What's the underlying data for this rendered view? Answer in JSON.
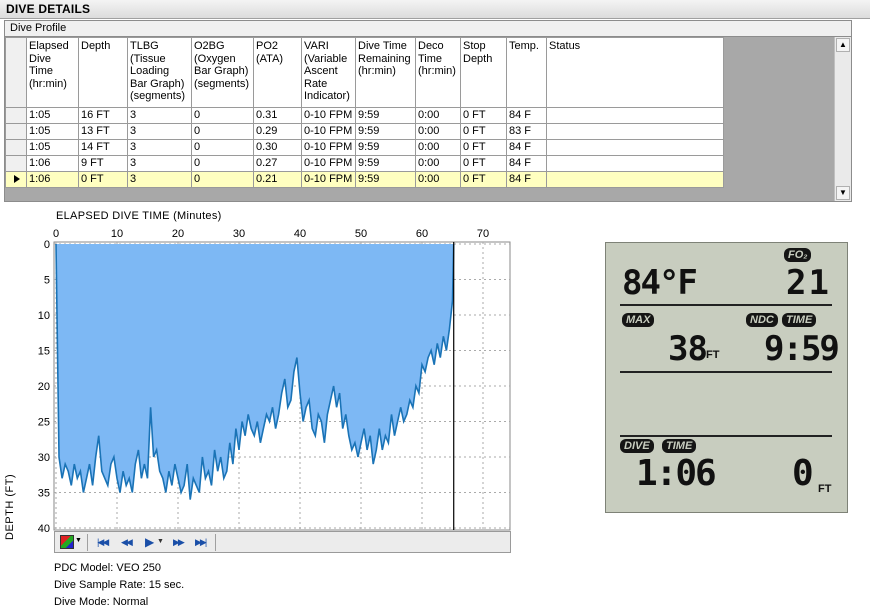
{
  "header": {
    "title": "DIVE DETAILS"
  },
  "profile": {
    "label": "Dive Profile",
    "columns": [
      "Elapsed Dive Time (hr:min)",
      "Depth",
      "TLBG (Tissue Loading Bar Graph) (segments)",
      "O2BG (Oxygen Bar Graph) (segments)",
      "PO2 (ATA)",
      "VARI (Variable Ascent Rate Indicator)",
      "Dive Time Remaining (hr:min)",
      "Deco Time (hr:min)",
      "Stop Depth",
      "Temp.",
      "Status"
    ],
    "rows": [
      [
        "1:05",
        "16 FT",
        "3",
        "0",
        "0.31",
        "0-10 FPM",
        "9:59",
        "0:00",
        "0 FT",
        "84 F",
        ""
      ],
      [
        "1:05",
        "13 FT",
        "3",
        "0",
        "0.29",
        "0-10 FPM",
        "9:59",
        "0:00",
        "0 FT",
        "83 F",
        ""
      ],
      [
        "1:05",
        "14 FT",
        "3",
        "0",
        "0.30",
        "0-10 FPM",
        "9:59",
        "0:00",
        "0 FT",
        "84 F",
        ""
      ],
      [
        "1:06",
        "9 FT",
        "3",
        "0",
        "0.27",
        "0-10 FPM",
        "9:59",
        "0:00",
        "0 FT",
        "84 F",
        ""
      ],
      [
        "1:06",
        "0 FT",
        "3",
        "0",
        "0.21",
        "0-10 FPM",
        "9:59",
        "0:00",
        "0 FT",
        "84 F",
        ""
      ]
    ],
    "selected_row": 4
  },
  "chart_data": {
    "type": "area",
    "title": "ELAPSED DIVE TIME (Minutes)",
    "xlabel": "ELAPSED DIVE TIME (Minutes)",
    "ylabel": "DEPTH (FT)",
    "xlim": [
      0,
      70
    ],
    "ylim": [
      0,
      40
    ],
    "y_inverted": true,
    "xticks": [
      "0",
      "10",
      "20",
      "30",
      "40",
      "50",
      "60",
      "70"
    ],
    "yticks": [
      "0",
      "5",
      "10",
      "15",
      "20",
      "25",
      "30",
      "35",
      "40"
    ],
    "fill_color": "#7db8f4",
    "line_color": "#1a73b6",
    "grid": true,
    "series": [
      {
        "x": [
          0,
          0.5,
          1,
          1.5,
          2,
          2.5,
          3,
          3.5,
          4,
          4.5,
          5,
          5.5,
          6,
          6.5,
          7,
          7.5,
          8,
          8.5,
          9,
          9.5,
          10,
          10.5,
          11,
          11.5,
          12,
          12.5,
          13,
          13.5,
          14,
          14.5,
          15,
          15.5,
          16,
          16.5,
          17,
          17.5,
          18,
          18.5,
          19,
          19.5,
          20,
          20.5,
          21,
          21.5,
          22,
          22.5,
          23,
          23.5,
          24,
          24.5,
          25,
          25.5,
          26,
          26.5,
          27,
          27.5,
          28,
          28.5,
          29,
          29.5,
          30,
          30.5,
          31,
          31.5,
          32,
          32.5,
          33,
          33.5,
          34,
          34.5,
          35,
          35.5,
          36,
          36.5,
          37,
          37.5,
          38,
          38.5,
          39,
          39.5,
          40,
          40.5,
          41,
          41.5,
          42,
          42.5,
          43,
          43.5,
          44,
          44.5,
          45,
          45.5,
          46,
          46.5,
          47,
          47.5,
          48,
          48.5,
          49,
          49.5,
          50,
          50.5,
          51,
          51.5,
          52,
          52.5,
          53,
          53.5,
          54,
          54.5,
          55,
          55.5,
          56,
          56.5,
          57,
          57.5,
          58,
          58.5,
          59,
          59.5,
          60,
          60.5,
          61,
          61.5,
          62,
          62.5,
          63,
          63.5,
          64,
          64.5,
          65,
          65.2
        ],
        "y": [
          0,
          30,
          33,
          31,
          32,
          34,
          31,
          33,
          32,
          35,
          33,
          31,
          34,
          30,
          27,
          32,
          33,
          34,
          31,
          30,
          33,
          35,
          32,
          34,
          33,
          35,
          31,
          29,
          33,
          31,
          33,
          23,
          30,
          29,
          32,
          33,
          35,
          32,
          34,
          31,
          33,
          35,
          34,
          31,
          36,
          33,
          34,
          35,
          30,
          33,
          32,
          34,
          29,
          32,
          30,
          33,
          32,
          28,
          31,
          26,
          29,
          25,
          27,
          24,
          26,
          27,
          25,
          28,
          26,
          24,
          25,
          23,
          26,
          24,
          21,
          19,
          23,
          22,
          18,
          16,
          21,
          25,
          23,
          22,
          26,
          27,
          24,
          25,
          28,
          24,
          22,
          20,
          23,
          21,
          26,
          24,
          27,
          29,
          28,
          30,
          28,
          26,
          29,
          27,
          31,
          29,
          26,
          29,
          27,
          28,
          24,
          27,
          25,
          23,
          25,
          24,
          22,
          23,
          20,
          21,
          17,
          18,
          16,
          15,
          17,
          14,
          16,
          13,
          15,
          12,
          8,
          0
        ]
      }
    ]
  },
  "info": {
    "model": "PDC Model: VEO 250",
    "rate": "Dive Sample Rate: 15 sec.",
    "mode": "Dive Mode: Normal"
  },
  "lcd": {
    "fo2_label": "FO₂",
    "temp": "84°F",
    "fo2": "21",
    "max_label": "MAX",
    "ndc_label": "NDC",
    "time_label": "TIME",
    "max_depth": "38",
    "max_unit": "FT",
    "ndc_time": "9:59",
    "dive_label": "DIVE",
    "dive_time_label": "TIME",
    "dive_time": "1:06",
    "depth": "0",
    "depth_unit": "FT"
  },
  "icons": [
    "color-picker-icon",
    "first-icon",
    "rewind-icon",
    "play-icon",
    "fast-forward-icon",
    "last-icon"
  ]
}
